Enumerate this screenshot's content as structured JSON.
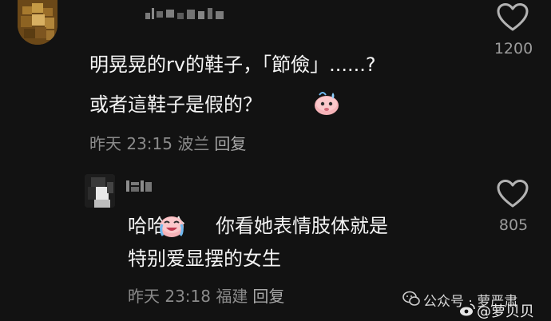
{
  "comment": {
    "line1": "明晃晃的rv的鞋子，「節儉」......?",
    "line2": "或者這鞋子是假的？",
    "emoji": "sweat-face-emoji",
    "meta": "昨天 23:15 波兰",
    "reply_label": "回复",
    "like_count": "1200"
  },
  "reply": {
    "prefix": "哈哈哈",
    "emoji": "crying-laughing-emoji",
    "line1_rest": "你看她表情肢体就是",
    "line2": "特别爱显摆的女生",
    "meta": "昨天 23:18 福建",
    "reply_label": "回复",
    "like_count": "805"
  },
  "watermark": {
    "wechat_label": "公众号 · 萝严肃",
    "weibo_label": "@萝贝贝"
  },
  "colors": {
    "background": "#121212",
    "text": "#f4f4f4",
    "meta": "#8b8b8b"
  }
}
